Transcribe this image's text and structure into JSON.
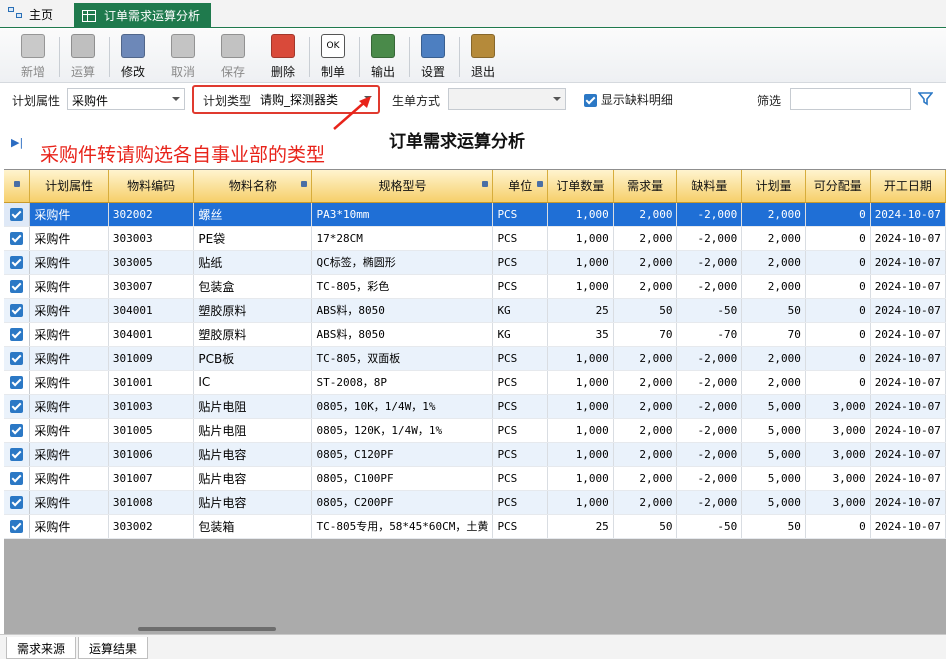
{
  "tabs": {
    "home": "主页",
    "active": "订单需求运算分析"
  },
  "toolbar": [
    {
      "label": "新增",
      "icon": "new-icon",
      "enabled": false
    },
    {
      "label": "运算",
      "icon": "run-icon",
      "enabled": false
    },
    {
      "label": "修改",
      "icon": "edit-icon",
      "enabled": true
    },
    {
      "label": "取消",
      "icon": "undo-icon",
      "enabled": false
    },
    {
      "label": "保存",
      "icon": "save-icon",
      "enabled": false
    },
    {
      "label": "删除",
      "icon": "delete-icon",
      "enabled": true
    },
    {
      "label": "制单",
      "icon": "ok-icon",
      "enabled": true
    },
    {
      "label": "输出",
      "icon": "export-icon",
      "enabled": true
    },
    {
      "label": "设置",
      "icon": "settings-icon",
      "enabled": true
    },
    {
      "label": "退出",
      "icon": "exit-icon",
      "enabled": true
    }
  ],
  "filters": {
    "plan_attr_label": "计划属性",
    "plan_attr_value": "采购件",
    "plan_type_label": "计划类型",
    "plan_type_value": "请购_探测器类",
    "gen_mode_label": "生单方式",
    "gen_mode_value": "",
    "show_shortage_label": "显示缺料明细",
    "show_shortage_checked": true,
    "filter_label": "筛选",
    "filter_value": ""
  },
  "page_title": "订单需求运算分析",
  "annotation": "采购件转请购选各自事业部的类型",
  "columns": [
    "计划属性",
    "物料编码",
    "物料名称",
    "规格型号",
    "单位",
    "订单数量",
    "需求量",
    "缺料量",
    "计划量",
    "可分配量",
    "开工日期"
  ],
  "rows": [
    [
      "采购件",
      "302002",
      "螺丝",
      "PA3*10mm",
      "PCS",
      "1,000",
      "2,000",
      "-2,000",
      "2,000",
      "0",
      "2024-10-07"
    ],
    [
      "采购件",
      "303003",
      "PE袋",
      "17*28CM",
      "PCS",
      "1,000",
      "2,000",
      "-2,000",
      "2,000",
      "0",
      "2024-10-07"
    ],
    [
      "采购件",
      "303005",
      "贴纸",
      "QC标签，椭圆形",
      "PCS",
      "1,000",
      "2,000",
      "-2,000",
      "2,000",
      "0",
      "2024-10-07"
    ],
    [
      "采购件",
      "303007",
      "包装盒",
      "TC-805，彩色",
      "PCS",
      "1,000",
      "2,000",
      "-2,000",
      "2,000",
      "0",
      "2024-10-07"
    ],
    [
      "采购件",
      "304001",
      "塑胶原料",
      "ABS料，8050",
      "KG",
      "25",
      "50",
      "-50",
      "50",
      "0",
      "2024-10-07"
    ],
    [
      "采购件",
      "304001",
      "塑胶原料",
      "ABS料，8050",
      "KG",
      "35",
      "70",
      "-70",
      "70",
      "0",
      "2024-10-07"
    ],
    [
      "采购件",
      "301009",
      "PCB板",
      "TC-805，双面板",
      "PCS",
      "1,000",
      "2,000",
      "-2,000",
      "2,000",
      "0",
      "2024-10-07"
    ],
    [
      "采购件",
      "301001",
      "IC",
      "ST-2008，8P",
      "PCS",
      "1,000",
      "2,000",
      "-2,000",
      "2,000",
      "0",
      "2024-10-07"
    ],
    [
      "采购件",
      "301003",
      "贴片电阻",
      "0805，10K，1/4W，1%",
      "PCS",
      "1,000",
      "2,000",
      "-2,000",
      "5,000",
      "3,000",
      "2024-10-07"
    ],
    [
      "采购件",
      "301005",
      "贴片电阻",
      "0805，120K，1/4W，1%",
      "PCS",
      "1,000",
      "2,000",
      "-2,000",
      "5,000",
      "3,000",
      "2024-10-07"
    ],
    [
      "采购件",
      "301006",
      "贴片电容",
      "0805，C120PF",
      "PCS",
      "1,000",
      "2,000",
      "-2,000",
      "5,000",
      "3,000",
      "2024-10-07"
    ],
    [
      "采购件",
      "301007",
      "贴片电容",
      "0805，C100PF",
      "PCS",
      "1,000",
      "2,000",
      "-2,000",
      "5,000",
      "3,000",
      "2024-10-07"
    ],
    [
      "采购件",
      "301008",
      "贴片电容",
      "0805，C200PF",
      "PCS",
      "1,000",
      "2,000",
      "-2,000",
      "5,000",
      "3,000",
      "2024-10-07"
    ],
    [
      "采购件",
      "303002",
      "包装箱",
      "TC-805专用，58*45*60CM，土黄",
      "PCS",
      "25",
      "50",
      "-50",
      "50",
      "0",
      "2024-10-07"
    ]
  ],
  "bottom_tabs": [
    "需求来源",
    "运算结果"
  ],
  "colors": {
    "accent": "#1f7a4d",
    "selection": "#1f6fd6",
    "annotation": "#e8231a",
    "header": "#f6cf6a"
  }
}
